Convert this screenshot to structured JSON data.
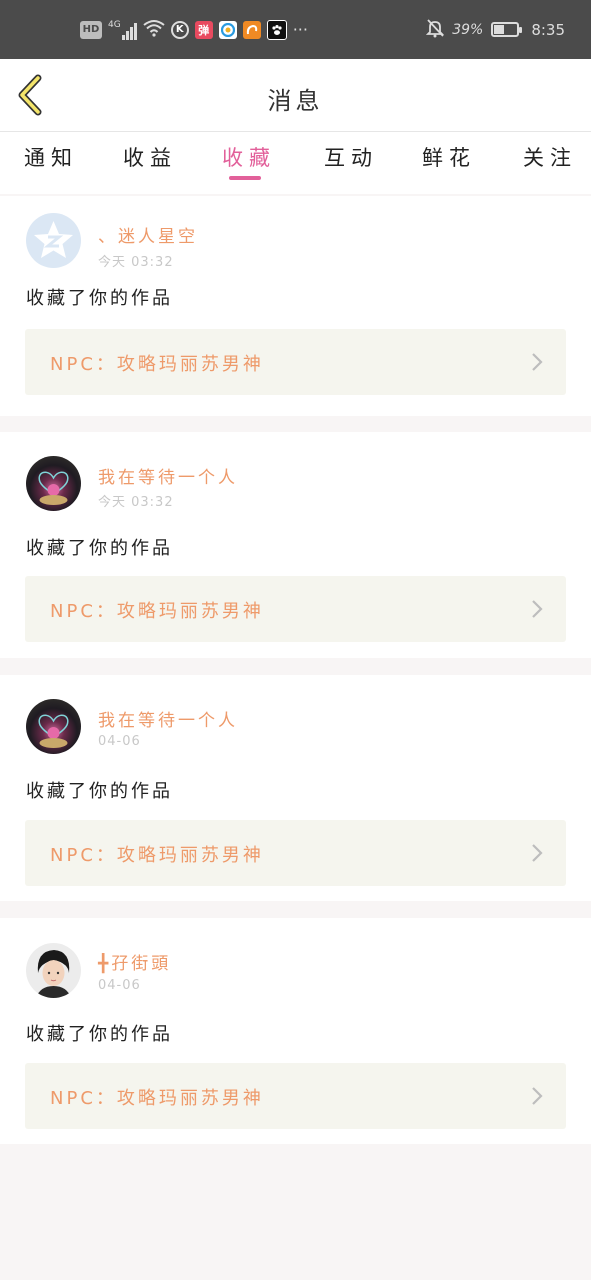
{
  "status_bar": {
    "left_icons": [
      "hd-icon",
      "4g-signal-icon",
      "wifi-icon",
      "k-app-icon",
      "dan-app-icon",
      "browser-app-icon",
      "uc-app-icon",
      "paw-app-icon",
      "more-dots-icon"
    ],
    "hd": "HD",
    "net": "4G",
    "k": "K",
    "dan": "弹",
    "dots": "···",
    "battery_percent": "39%",
    "battery_level": 0.39,
    "time": "8:35"
  },
  "header": {
    "title": "消息"
  },
  "tabs": [
    {
      "label": "通知"
    },
    {
      "label": "收益"
    },
    {
      "label": "收藏",
      "active": true
    },
    {
      "label": "互动"
    },
    {
      "label": "鲜花"
    },
    {
      "label": "关注"
    }
  ],
  "messages": [
    {
      "username": "、迷人星空",
      "time": "今天 03:32",
      "action": "收藏了你的作品",
      "work": "NPC：攻略玛丽苏男神",
      "avatar": "qzone-avatar"
    },
    {
      "username": "我在等待一个人",
      "time": "今天 03:32",
      "action": "收藏了你的作品",
      "work": "NPC：攻略玛丽苏男神",
      "avatar": "heart-flower-avatar"
    },
    {
      "username": "我在等待一个人",
      "time": "04-06",
      "action": "收藏了你的作品",
      "work": "NPC：攻略玛丽苏男神",
      "avatar": "heart-flower-avatar"
    },
    {
      "username": "╋孖街頭",
      "time": "04-06",
      "action": "收藏了你的作品",
      "work": "NPC：攻略玛丽苏男神",
      "avatar": "person-avatar"
    }
  ],
  "colors": {
    "accent": "#e2609a",
    "name": "#ee9a6a",
    "link_bg": "#f5f5ee",
    "status_bar": "#4b4b4b"
  }
}
